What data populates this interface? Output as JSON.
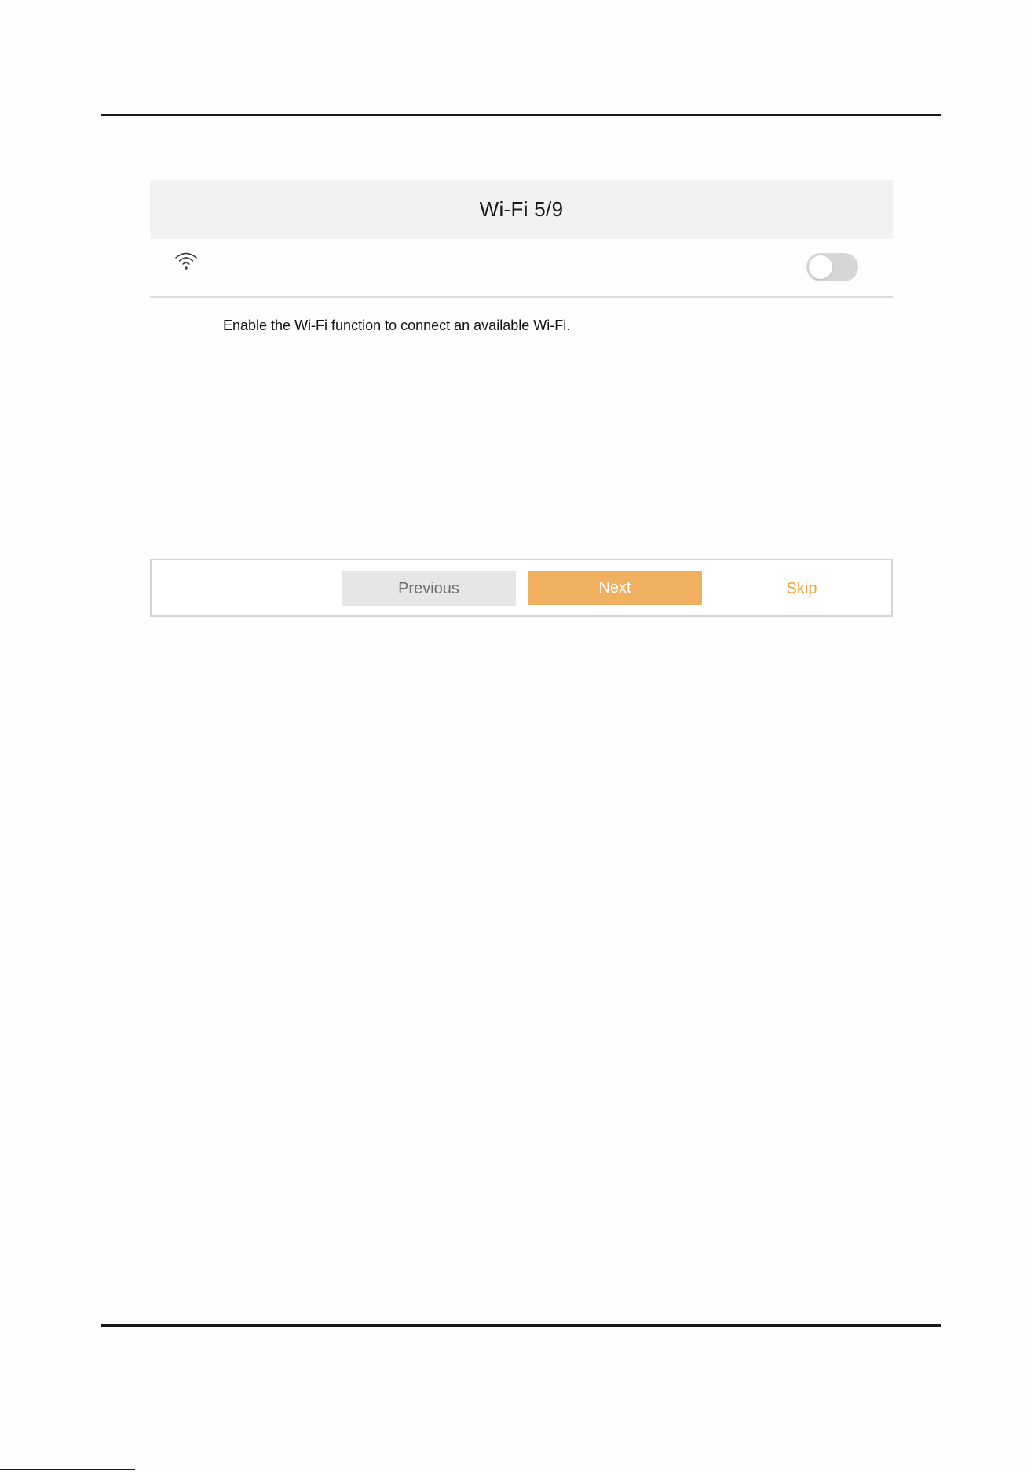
{
  "header": {
    "title": "Wi-Fi 5/9"
  },
  "wifi": {
    "icon": "wifi-icon",
    "toggle_state": "off",
    "hint": "Enable the Wi-Fi function to connect an available Wi-Fi."
  },
  "footer": {
    "previous_label": "Previous",
    "next_label": "Next",
    "skip_label": "Skip"
  },
  "colors": {
    "accent": "#f0b05f",
    "skip_text": "#f0a23c",
    "title_bar": "#f2f2f2",
    "toggle_off": "#d6d6d6"
  }
}
